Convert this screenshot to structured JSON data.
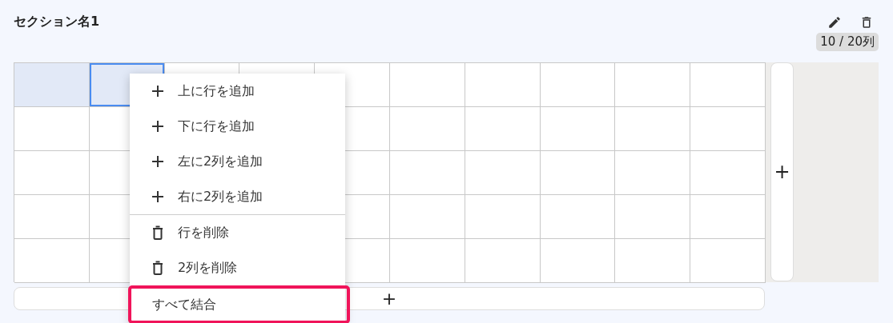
{
  "section": {
    "title": "セクション名1",
    "column_count": "10 / 20列"
  },
  "grid": {
    "top_row_cells": [
      {
        "selected": true,
        "focused": false
      },
      {
        "selected": true,
        "focused": true
      },
      {
        "selected": false,
        "focused": false
      },
      {
        "selected": false,
        "focused": false
      },
      {
        "selected": false,
        "focused": false
      },
      {
        "selected": false,
        "focused": false
      },
      {
        "selected": false,
        "focused": false
      },
      {
        "selected": false,
        "focused": false
      },
      {
        "selected": false,
        "focused": false
      },
      {
        "selected": false,
        "focused": false
      }
    ],
    "add_column": "+",
    "add_row": "+"
  },
  "context_menu": {
    "items": [
      {
        "kind": "add",
        "label": "上に行を追加",
        "highlighted": false
      },
      {
        "kind": "add",
        "label": "下に行を追加",
        "highlighted": false
      },
      {
        "kind": "add",
        "label": "左に2列を追加",
        "highlighted": false
      },
      {
        "kind": "add",
        "label": "右に2列を追加",
        "highlighted": false
      },
      {
        "kind": "delete",
        "label": "行を削除",
        "highlighted": false
      },
      {
        "kind": "delete",
        "label": "2列を削除",
        "highlighted": false
      },
      {
        "kind": "merge",
        "label": "すべて結合",
        "highlighted": true
      }
    ]
  }
}
